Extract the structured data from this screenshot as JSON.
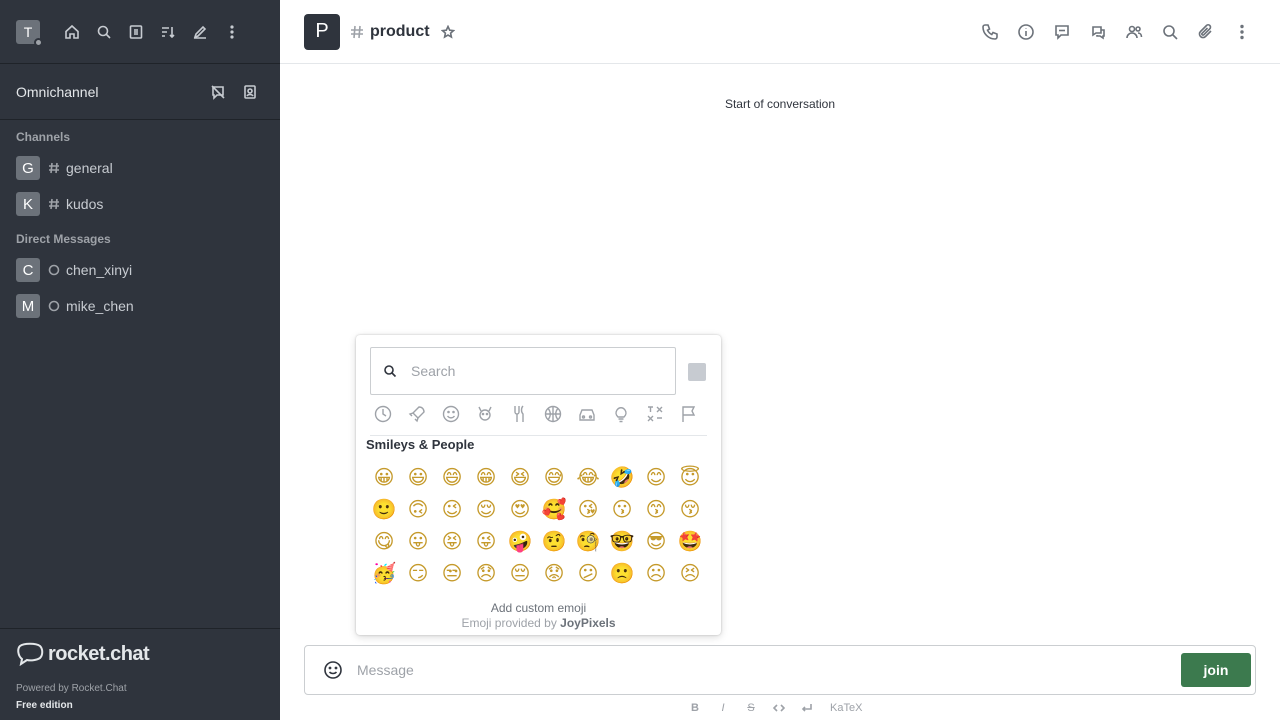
{
  "user": {
    "avatar_initial": "T"
  },
  "sidebar": {
    "omnichannel_label": "Omnichannel",
    "channels_title": "Channels",
    "channels": [
      {
        "initial": "G",
        "name": "general"
      },
      {
        "initial": "K",
        "name": "kudos"
      }
    ],
    "dm_title": "Direct Messages",
    "dms": [
      {
        "initial": "C",
        "name": "chen_xinyi"
      },
      {
        "initial": "M",
        "name": "mike_chen"
      }
    ],
    "logo_text": "rocket.chat",
    "powered_by": "Powered by Rocket.Chat",
    "edition": "Free edition"
  },
  "header": {
    "avatar_initial": "P",
    "room_name": "product"
  },
  "main": {
    "start_text": "Start of conversation"
  },
  "composer": {
    "placeholder": "Message",
    "join_label": "join",
    "katex_label": "KaTeX",
    "format_buttons": [
      "B",
      "I",
      "S"
    ]
  },
  "emoji_picker": {
    "search_placeholder": "Search",
    "category_title": "Smileys & People",
    "emojis": [
      "😀",
      "😃",
      "😄",
      "😁",
      "😆",
      "😅",
      "😂",
      "🤣",
      "😊",
      "😇",
      "🙂",
      "🙃",
      "😉",
      "😌",
      "😍",
      "🥰",
      "😘",
      "😗",
      "😙",
      "😚",
      "😋",
      "😛",
      "😝",
      "😜",
      "🤪",
      "🤨",
      "🧐",
      "🤓",
      "😎",
      "🤩",
      "🥳",
      "😏",
      "😒",
      "😞",
      "😔",
      "😟",
      "😕",
      "🙁",
      "☹",
      "😣"
    ],
    "add_custom_label": "Add custom emoji",
    "provided_prefix": "Emoji provided by",
    "provider": "JoyPixels"
  }
}
